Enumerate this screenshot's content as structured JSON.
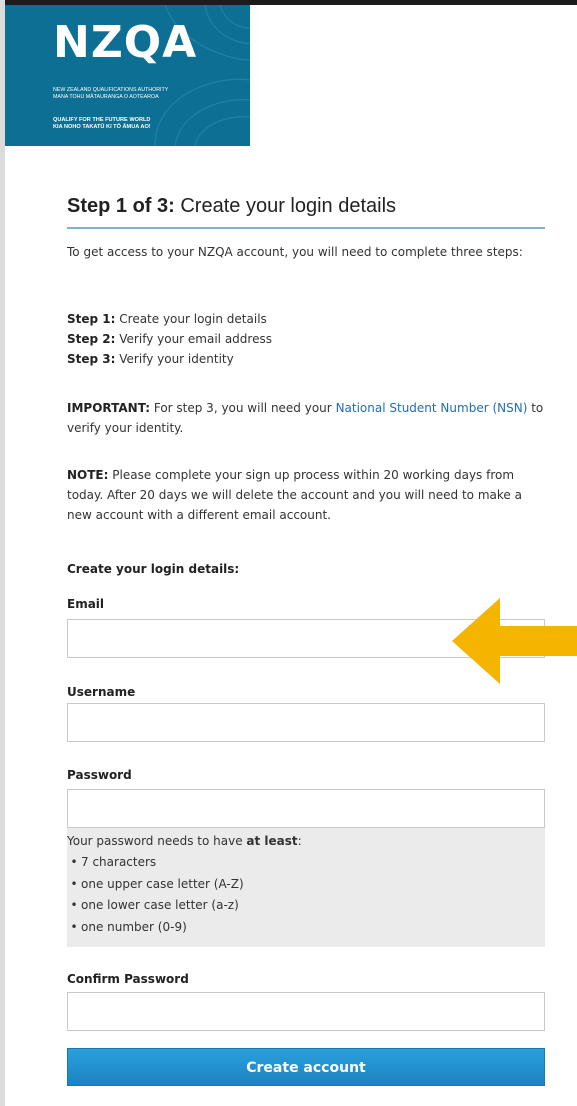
{
  "header": {
    "logo_text": "NZQA",
    "org_name_en": "NEW ZEALAND QUALIFICATIONS AUTHORITY",
    "org_name_mi": "MANA TOHU MĀTAURANGA O AOTEAROA",
    "slogan_en": "QUALIFY FOR THE FUTURE WORLD",
    "slogan_mi": "KIA NOHO TAKATŪ KI TŌ ĀMUA AO!"
  },
  "title": {
    "step": "Step 1 of 3:",
    "text": "Create your login details"
  },
  "intro": {
    "text": "To get access to your NZQA account, you will need to complete three steps:"
  },
  "steps": [
    {
      "label": "Step 1:",
      "text": "Create your login details"
    },
    {
      "label": "Step 2:",
      "text": "Verify your email address"
    },
    {
      "label": "Step 3:",
      "text": "Verify your identity"
    }
  ],
  "important": {
    "label": "IMPORTANT:",
    "text_before": "For step 3, you will need your",
    "link": "National Student Number (NSN)",
    "text_after": "to verify your identity."
  },
  "note": {
    "label": "NOTE:",
    "text": "Please complete your sign up process within 20 working days from today. After 20 days we will delete the account and you will need to make a new account with a different email account."
  },
  "form": {
    "heading": "Create your login details:",
    "email_label": "Email",
    "email_value": "",
    "username_label": "Username",
    "username_value": "",
    "password_label": "Password",
    "password_value": "",
    "password_rules_intro": "Your password needs to have",
    "password_rules_emphasis": "at least",
    "password_rules_colon": ":",
    "password_rules": [
      "7 characters",
      "one upper case letter (A-Z)",
      "one lower case letter (a-z)",
      "one number (0-9)"
    ],
    "confirm_label": "Confirm Password",
    "confirm_value": "",
    "submit_label": "Create account"
  },
  "colors": {
    "header_bg": "#0d6f93",
    "button_bg": "#1a8fcf",
    "link": "#1f6db5",
    "arrow": "#f5b400"
  },
  "icons": {
    "arrow": "arrow-left-icon"
  }
}
